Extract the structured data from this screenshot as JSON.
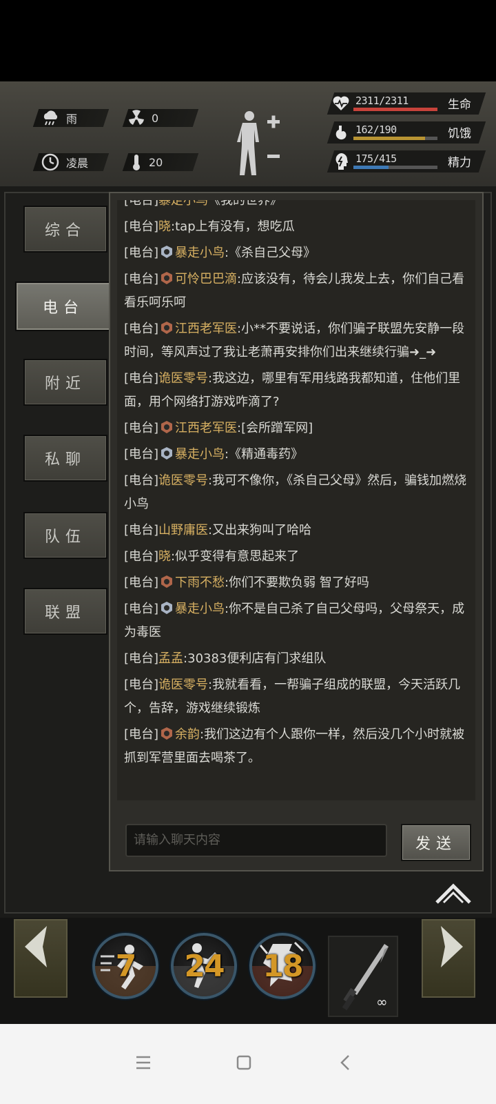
{
  "status": {
    "weather": "雨",
    "radiation": "0",
    "time_of_day": "凌晨",
    "temperature": "20",
    "bars": [
      {
        "label": "生命",
        "value": "2311/2311",
        "fraction": 1.0,
        "color": "#c8433b",
        "icon": "heart-pulse-icon"
      },
      {
        "label": "饥饿",
        "value": "162/190",
        "fraction": 0.853,
        "color": "#b89433",
        "icon": "stomach-icon"
      },
      {
        "label": "精力",
        "value": "175/415",
        "fraction": 0.42,
        "color": "#3e79b5",
        "icon": "head-energy-icon"
      }
    ]
  },
  "tabs": [
    {
      "label": "综合",
      "active": false
    },
    {
      "label": "电台",
      "active": true
    },
    {
      "label": "附近",
      "active": false
    },
    {
      "label": "私聊",
      "active": false
    },
    {
      "label": "队伍",
      "active": false
    },
    {
      "label": "联盟",
      "active": false
    }
  ],
  "chat": {
    "channel_tag": "[电台]",
    "messages": [
      {
        "name": "暴走小鸟",
        "text": "《我的世界》",
        "badge": "none"
      },
      {
        "name": "晓",
        "text": ":tap上有没有，想吃瓜",
        "badge": "none"
      },
      {
        "name": "暴走小鸟",
        "text": ":《杀自己父母》",
        "badge": "silver"
      },
      {
        "name": "可怜巴巴滴",
        "text": ":应该没有，待会儿我发上去，你们自己看看乐呵乐呵",
        "badge": "bronze"
      },
      {
        "name": "江西老军医",
        "text": ":小**不要说话，你们骗子联盟先安静一段时间，等风声过了我让老萧再安排你们出来继续行骗➜_➜",
        "badge": "bronze"
      },
      {
        "name": "诡医零号",
        "text": ":我这边，哪里有军用线路我都知道，住他们里面，用个网络打游戏咋滴了?",
        "badge": "none"
      },
      {
        "name": "江西老军医",
        "text": ":[会所蹭军网]",
        "badge": "bronze"
      },
      {
        "name": "暴走小鸟",
        "text": ":《精通毒药》",
        "badge": "silver"
      },
      {
        "name": "诡医零号",
        "text": ":我可不像你，《杀自己父母》然后，骗钱加燃烧小鸟",
        "badge": "none"
      },
      {
        "name": "山野庸医",
        "text": ":又出来狗叫了哈哈",
        "badge": "none"
      },
      {
        "name": "晓",
        "text": ":似乎变得有意思起来了",
        "badge": "none"
      },
      {
        "name": "下雨不愁",
        "text": ":你们不要欺负弱 智了好吗",
        "badge": "bronze"
      },
      {
        "name": "暴走小鸟",
        "text": ":你不是自己杀了自己父母吗，父母祭天，成为毒医",
        "badge": "silver"
      },
      {
        "name": "孟孟",
        "text": ":30383便利店有门求组队",
        "badge": "none"
      },
      {
        "name": "诡医零号",
        "text": ":我就看看，一帮骗子组成的联盟，今天活跃几个，告辞，游戏继续锻炼",
        "badge": "none"
      },
      {
        "name": "余韵",
        "text": ":我们这边有个人跟你一样，然后没几个小时就被抓到军营里面去喝茶了。",
        "badge": "bronze"
      }
    ],
    "input_placeholder": "请输入聊天内容",
    "send_label": "发送"
  },
  "skills": [
    {
      "count": "7"
    },
    {
      "count": "24"
    },
    {
      "count": "18"
    }
  ],
  "weapon": {
    "count": "∞"
  }
}
